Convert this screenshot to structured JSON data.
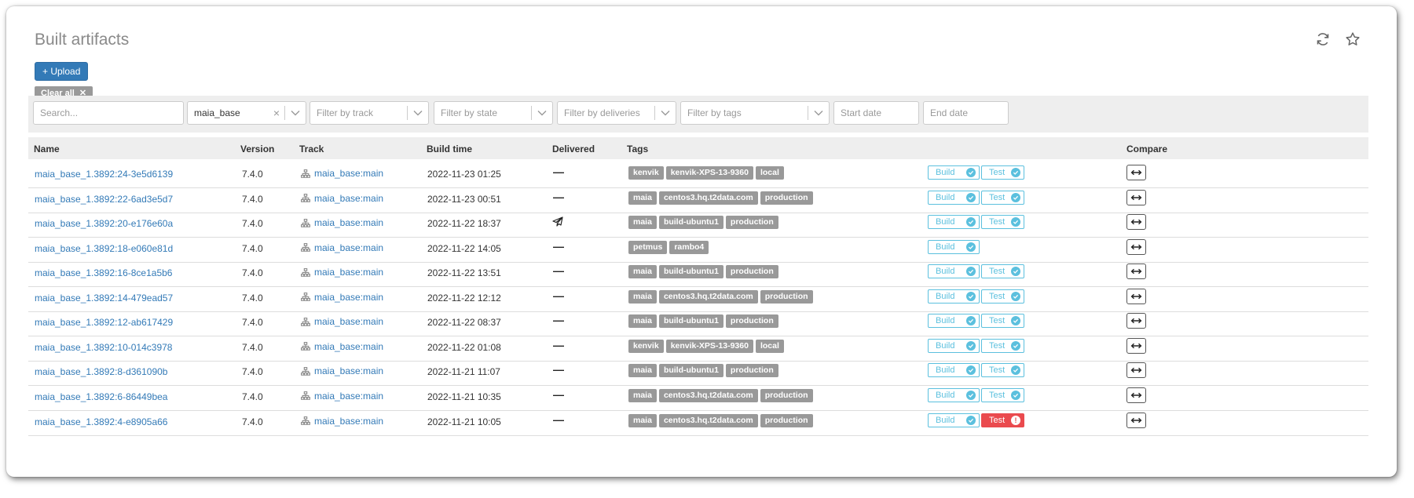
{
  "page": {
    "title": "Built artifacts"
  },
  "toolbar": {
    "upload_label": "+ Upload",
    "clear_all_label": "Clear all"
  },
  "filters": {
    "search_placeholder": "Search...",
    "project_value": "maia_base",
    "track_placeholder": "Filter by track",
    "state_placeholder": "Filter by state",
    "deliveries_placeholder": "Filter by deliveries",
    "tags_placeholder": "Filter by tags",
    "start_date_placeholder": "Start date",
    "end_date_placeholder": "End date"
  },
  "table": {
    "headers": [
      "Name",
      "Version",
      "Track",
      "Build time",
      "Delivered",
      "Tags",
      "Compare"
    ],
    "build_label": "Build",
    "test_label": "Test",
    "rows": [
      {
        "name": "maia_base_1.3892:24-3e5d6139",
        "version": "7.4.0",
        "track": "maia_base:main",
        "build_time": "2022-11-23 01:25",
        "delivered": "—",
        "tags": [
          "kenvik",
          "kenvik-XPS-13-9360",
          "local"
        ],
        "build": "ok",
        "test": "ok"
      },
      {
        "name": "maia_base_1.3892:22-6ad3e5d7",
        "version": "7.4.0",
        "track": "maia_base:main",
        "build_time": "2022-11-23 00:51",
        "delivered": "—",
        "tags": [
          "maia",
          "centos3.hq.t2data.com",
          "production"
        ],
        "build": "ok",
        "test": "ok"
      },
      {
        "name": "maia_base_1.3892:20-e176e60a",
        "version": "7.4.0",
        "track": "maia_base:main",
        "build_time": "2022-11-22 18:37",
        "delivered": "sent",
        "tags": [
          "maia",
          "build-ubuntu1",
          "production"
        ],
        "build": "ok",
        "test": "ok"
      },
      {
        "name": "maia_base_1.3892:18-e060e81d",
        "version": "7.4.0",
        "track": "maia_base:main",
        "build_time": "2022-11-22 14:05",
        "delivered": "—",
        "tags": [
          "petmus",
          "rambo4"
        ],
        "build": "ok",
        "test": "none"
      },
      {
        "name": "maia_base_1.3892:16-8ce1a5b6",
        "version": "7.4.0",
        "track": "maia_base:main",
        "build_time": "2022-11-22 13:51",
        "delivered": "—",
        "tags": [
          "maia",
          "build-ubuntu1",
          "production"
        ],
        "build": "ok",
        "test": "ok"
      },
      {
        "name": "maia_base_1.3892:14-479ead57",
        "version": "7.4.0",
        "track": "maia_base:main",
        "build_time": "2022-11-22 12:12",
        "delivered": "—",
        "tags": [
          "maia",
          "centos3.hq.t2data.com",
          "production"
        ],
        "build": "ok",
        "test": "ok"
      },
      {
        "name": "maia_base_1.3892:12-ab617429",
        "version": "7.4.0",
        "track": "maia_base:main",
        "build_time": "2022-11-22 08:37",
        "delivered": "—",
        "tags": [
          "maia",
          "build-ubuntu1",
          "production"
        ],
        "build": "ok",
        "test": "ok"
      },
      {
        "name": "maia_base_1.3892:10-014c3978",
        "version": "7.4.0",
        "track": "maia_base:main",
        "build_time": "2022-11-22 01:08",
        "delivered": "—",
        "tags": [
          "kenvik",
          "kenvik-XPS-13-9360",
          "local"
        ],
        "build": "ok",
        "test": "ok"
      },
      {
        "name": "maia_base_1.3892:8-d361090b",
        "version": "7.4.0",
        "track": "maia_base:main",
        "build_time": "2022-11-21 11:07",
        "delivered": "—",
        "tags": [
          "maia",
          "build-ubuntu1",
          "production"
        ],
        "build": "ok",
        "test": "ok"
      },
      {
        "name": "maia_base_1.3892:6-86449bea",
        "version": "7.4.0",
        "track": "maia_base:main",
        "build_time": "2022-11-21 10:35",
        "delivered": "—",
        "tags": [
          "maia",
          "centos3.hq.t2data.com",
          "production"
        ],
        "build": "ok",
        "test": "ok"
      },
      {
        "name": "maia_base_1.3892:4-e8905a66",
        "version": "7.4.0",
        "track": "maia_base:main",
        "build_time": "2022-11-21 10:05",
        "delivered": "—",
        "tags": [
          "maia",
          "centos3.hq.t2data.com",
          "production"
        ],
        "build": "ok",
        "test": "fail"
      }
    ]
  },
  "colors": {
    "link": "#337ab7",
    "status_ok": "#5bc0de",
    "status_fail": "#ea4a4e",
    "tag": "#999999",
    "primary": "#337ab7"
  },
  "icons": {
    "refresh": "refresh-icon",
    "favorite": "star-icon",
    "track": "sitemap-icon",
    "compare": "compare-arrows-icon",
    "delivered": "paper-plane-icon"
  }
}
